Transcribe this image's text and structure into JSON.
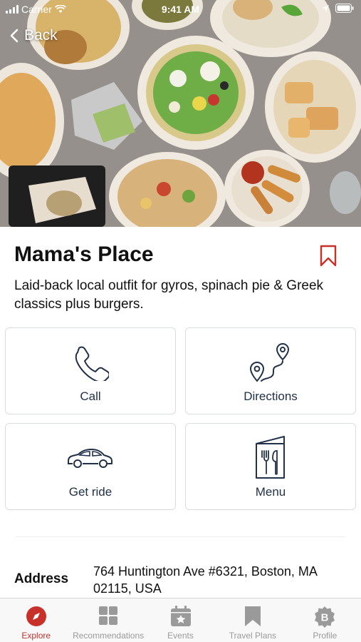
{
  "status_bar": {
    "carrier": "Carrier",
    "time": "9:41 AM"
  },
  "nav": {
    "back_label": "Back"
  },
  "place": {
    "name": "Mama's Place",
    "description": "Laid-back local outfit for gyros, spinach pie & Greek classics plus burgers."
  },
  "actions": {
    "call": "Call",
    "directions": "Directions",
    "get_ride": "Get ride",
    "menu": "Menu"
  },
  "address": {
    "label": "Address",
    "value": "764 Huntington Ave #6321, Boston, MA 02115, USA"
  },
  "tabs": [
    {
      "label": "Explore",
      "icon": "compass-icon",
      "active": true
    },
    {
      "label": "Recommendations",
      "icon": "grid-icon",
      "active": false
    },
    {
      "label": "Events",
      "icon": "calendar-star-icon",
      "active": false
    },
    {
      "label": "Travel Plans",
      "icon": "bookmark-icon",
      "active": false
    },
    {
      "label": "Profile",
      "icon": "profile-badge-icon",
      "active": false
    }
  ],
  "colors": {
    "accent": "#c8302a",
    "icon_navy": "#213149",
    "card_border": "#d9dde2"
  }
}
